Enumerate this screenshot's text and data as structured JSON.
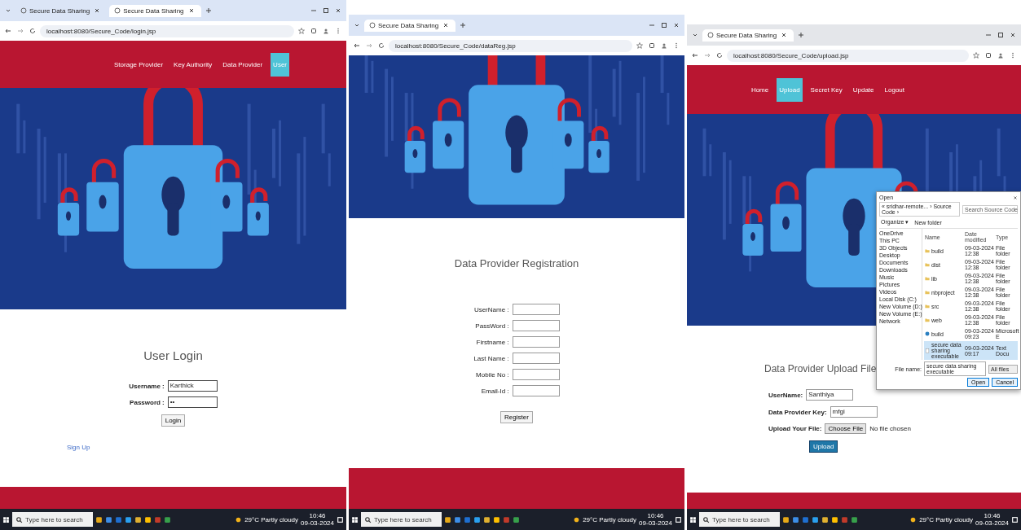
{
  "windows": [
    {
      "kind": "login",
      "tabs": [
        {
          "label": "Secure Data Sharing",
          "selected": false
        },
        {
          "label": "Secure Data Sharing",
          "selected": true
        }
      ],
      "url": "localhost:8080/Secure_Code/login.jsp",
      "nav": [
        {
          "label": "Storage Provider",
          "selected": false
        },
        {
          "label": "Key Authority",
          "selected": false
        },
        {
          "label": "Data Provider",
          "selected": false
        },
        {
          "label": "User",
          "selected": true
        }
      ],
      "form": {
        "title": "User Login",
        "fields": [
          {
            "kind": "text",
            "label": "Username :",
            "value": "Karthick"
          },
          {
            "kind": "text",
            "label": "Password :",
            "value": "••"
          }
        ],
        "button": "Login"
      },
      "link": "Sign Up",
      "taskbar": {
        "search_placeholder": "Type here to search",
        "weather": "29°C Partly cloudy",
        "time": "10:46",
        "date": "09-03-2024"
      }
    },
    {
      "kind": "register",
      "tabs": [
        {
          "label": "Secure Data Sharing",
          "selected": true
        }
      ],
      "url": "localhost:8080/Secure_Code/dataReg.jsp",
      "form": {
        "title": "Data Provider Registration",
        "fields": [
          {
            "kind": "text",
            "label": "UserName :"
          },
          {
            "kind": "text",
            "label": "PassWord :"
          },
          {
            "kind": "text",
            "label": "Firstname :"
          },
          {
            "kind": "text",
            "label": "Last Name :"
          },
          {
            "kind": "text",
            "label": "Mobile No :"
          },
          {
            "kind": "text",
            "label": "Email-Id :"
          }
        ],
        "button": "Register"
      },
      "taskbar": {
        "search_placeholder": "Type here to search",
        "weather": "29°C Partly cloudy",
        "time": "10:46",
        "date": "09-03-2024"
      }
    },
    {
      "kind": "upload",
      "tabs": [
        {
          "label": "Secure Data Sharing",
          "selected": true
        }
      ],
      "url": "localhost:8080/Secure_Code/upload.jsp",
      "nav": [
        {
          "label": "Home",
          "selected": false
        },
        {
          "label": "Upload",
          "selected": true
        },
        {
          "label": "Secret Key",
          "selected": false
        },
        {
          "label": "Update",
          "selected": false
        },
        {
          "label": "Logout",
          "selected": false
        }
      ],
      "form": {
        "title": "Data Provider Upload File",
        "fields": [
          {
            "kind": "text",
            "label": "UserName:",
            "value": "Santhiya"
          },
          {
            "kind": "text",
            "label": "Data Provider Key:",
            "value": "mfgi"
          },
          {
            "kind": "file",
            "label": "Upload Your File:",
            "button": "Choose File",
            "value": "No file chosen"
          }
        ],
        "button": "Upload"
      },
      "dialog": {
        "title": "Open",
        "path": "« sridhar-remote... › Source Code ›",
        "search_placeholder": "Search Source Code",
        "toolbar": [
          "Organize ▾",
          "New folder"
        ],
        "places": [
          "OneDrive",
          "This PC",
          "3D Objects",
          "Desktop",
          "Documents",
          "Downloads",
          "Music",
          "Pictures",
          "Videos",
          "Local Disk (C:)",
          "New Volume (D:)",
          "New Volume (E:)",
          "Network"
        ],
        "columns": [
          "Name",
          "Date modified",
          "Type"
        ],
        "files": [
          {
            "kind": "folder",
            "name": "build",
            "date": "09-03-2024 12:38",
            "type": "File folder",
            "selected": false
          },
          {
            "kind": "folder",
            "name": "dist",
            "date": "09-03-2024 12:38",
            "type": "File folder",
            "selected": false
          },
          {
            "kind": "folder",
            "name": "lib",
            "date": "09-03-2024 12:38",
            "type": "File folder",
            "selected": false
          },
          {
            "kind": "folder",
            "name": "nbproject",
            "date": "09-03-2024 12:38",
            "type": "File folder",
            "selected": false
          },
          {
            "kind": "folder",
            "name": "src",
            "date": "09-03-2024 12:38",
            "type": "File folder",
            "selected": false
          },
          {
            "kind": "folder",
            "name": "web",
            "date": "09-03-2024 12:38",
            "type": "File folder",
            "selected": false
          },
          {
            "kind": "app",
            "name": "build",
            "date": "09-03-2024 09:23",
            "type": "Microsoft E",
            "selected": false
          },
          {
            "kind": "doc",
            "name": "secure data sharing executable",
            "date": "09-03-2024 09:17",
            "type": "Text Docu",
            "selected": true
          }
        ],
        "filename_label": "File name:",
        "filename": "secure data sharing executable",
        "filter": "All files",
        "open": "Open",
        "cancel": "Cancel"
      },
      "taskbar": {
        "search_placeholder": "Type here to search",
        "weather": "29°C Partly cloudy",
        "time": "10:46",
        "date": "09-03-2024"
      }
    }
  ]
}
